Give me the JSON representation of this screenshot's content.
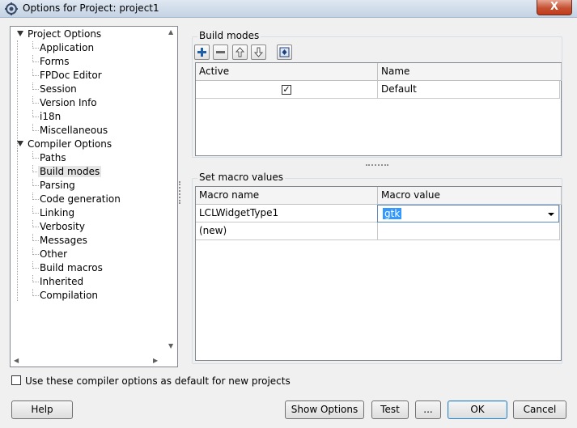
{
  "window": {
    "title": "Options for Project: project1",
    "close_symbol": "X"
  },
  "tree": {
    "groups": [
      {
        "label": "Project Options",
        "children": [
          "Application",
          "Forms",
          "FPDoc Editor",
          "Session",
          "Version Info",
          "i18n",
          "Miscellaneous"
        ]
      },
      {
        "label": "Compiler Options",
        "children": [
          "Paths",
          "Build modes",
          "Parsing",
          "Code generation",
          "Linking",
          "Verbosity",
          "Messages",
          "Other",
          "Build macros",
          "Inherited",
          "Compilation"
        ]
      }
    ],
    "selected": "Build modes"
  },
  "build_modes": {
    "title": "Build modes",
    "toolbar": [
      "add-icon",
      "remove-icon",
      "move-up-icon",
      "move-down-icon",
      "diff-icon"
    ],
    "columns": [
      "Active",
      "Name"
    ],
    "rows": [
      {
        "active": true,
        "name": "Default"
      }
    ]
  },
  "macros": {
    "title": "Set macro values",
    "columns": [
      "Macro name",
      "Macro value"
    ],
    "rows": [
      {
        "name": "LCLWidgetType1",
        "value": "gtk"
      },
      {
        "name": "(new)",
        "value": ""
      }
    ]
  },
  "footer": {
    "default_checkbox_label": "Use these compiler options as default for new projects",
    "default_checked": false,
    "buttons": {
      "help": "Help",
      "show_options": "Show Options",
      "test": "Test",
      "more": "...",
      "ok": "OK",
      "cancel": "Cancel"
    }
  }
}
